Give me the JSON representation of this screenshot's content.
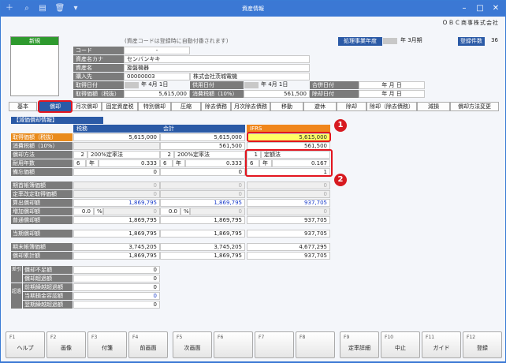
{
  "window": {
    "title": "資産情報",
    "company": "ＯＢＣ商事株式会社"
  },
  "photo": {
    "header": "新規"
  },
  "note": "(資産コードは登録時に自動付番されます)",
  "fiscal": {
    "label": "処理事業年度",
    "value": "年 3月期"
  },
  "count": {
    "label": "登録件数",
    "value": "36"
  },
  "fields": {
    "code": {
      "label": "コード",
      "value": "-"
    },
    "kana": {
      "label": "資産名カナ",
      "value": "センバンキキ"
    },
    "name": {
      "label": "資産名",
      "value": "旋盤機器"
    },
    "supplier": {
      "label": "購入先",
      "code": "00000003",
      "name": "株式会社茨城電機"
    },
    "acquired": {
      "label": "取得日付",
      "value": "年 4月 1日"
    },
    "inservice": {
      "label": "供用日付",
      "value": "年 4月 1日"
    },
    "merged": {
      "label": "合併日付",
      "value": "年 月 日"
    },
    "cost": {
      "label": "取得価額（税抜）",
      "value": "5,615,000"
    },
    "tax": {
      "label": "消費税額（10%）",
      "value": "561,500"
    },
    "disposal": {
      "label": "除却日付",
      "value": "年 月 日"
    }
  },
  "tabs": [
    "基本",
    "償却",
    "月次償却",
    "固定資産税",
    "特別償却",
    "圧縮",
    "除去債務",
    "月次除去債務",
    "移動",
    "遊休",
    "除却",
    "除却（除去債務）",
    "減損",
    "償却方法変更"
  ],
  "section_title": "【減価償却情報】",
  "columns": {
    "tax": "税務",
    "accounting": "会計",
    "ifrs": "IFRS"
  },
  "rows": {
    "cost": {
      "label": "取得価額（税抜）",
      "tax": "5,615,000",
      "acc": "5,615,000",
      "ifrs": "5,615,000"
    },
    "vat": {
      "label": "消費税額（10%）",
      "acc": "561,500",
      "ifrs": "561,500"
    },
    "method": {
      "label": "償却方法",
      "tax_no": "2",
      "tax": "200%定率法",
      "acc_no": "2",
      "acc": "200%定率法",
      "ifrs_no": "1",
      "ifrs": "定額法"
    },
    "life": {
      "label": "耐用年数",
      "tax_years": "6",
      "unit": "年",
      "tax_rate": "0.333",
      "acc_years": "6",
      "acc_rate": "0.333",
      "ifrs_years": "6",
      "ifrs_rate": "0.167"
    },
    "memo": {
      "label": "備忘価額",
      "tax": "0",
      "acc": "0",
      "ifrs": "1"
    },
    "begin_book": {
      "label": "期首帳簿価額",
      "tax": "0",
      "acc": "0",
      "ifrs": "0"
    },
    "fixed_change": {
      "label": "定率改定取得価額",
      "tax": "0",
      "acc": "0",
      "ifrs": "0"
    },
    "calc_dep": {
      "label": "算出償却額",
      "tax": "1,869,795",
      "acc": "1,869,795",
      "ifrs": "937,705"
    },
    "extra_dep": {
      "label": "増加償却額",
      "pct": "0.0",
      "pct_unit": "%",
      "tax": "0",
      "acc": "0",
      "ifrs": "0"
    },
    "normal_dep": {
      "label": "普通償却額",
      "tax": "1,869,795",
      "acc": "1,869,795",
      "ifrs": "937,705"
    },
    "current_dep": {
      "label": "当期償却額",
      "tax": "1,869,795",
      "acc": "1,869,795",
      "ifrs": "937,705"
    },
    "end_book": {
      "label": "期末帳簿価額",
      "tax": "3,745,205",
      "acc": "3,745,205",
      "ifrs": "4,677,295"
    },
    "accum": {
      "label": "償却累計額",
      "tax": "1,869,795",
      "acc": "1,869,795",
      "ifrs": "937,705"
    }
  },
  "excess": {
    "side1": "差引",
    "side2": "超過",
    "rows": [
      {
        "label": "償却不足額",
        "value": "0"
      },
      {
        "label": "償却超過額",
        "value": "0"
      },
      {
        "label": "前期繰越超過額",
        "value": "0"
      },
      {
        "label": "当期損金容認額",
        "value": "0"
      },
      {
        "label": "翌期繰越超過額",
        "value": "0"
      }
    ]
  },
  "badges": [
    "1",
    "2"
  ],
  "fkeys": [
    {
      "n": "F1",
      "t": "ヘルプ"
    },
    {
      "n": "F2",
      "t": "画像"
    },
    {
      "n": "F3",
      "t": "付箋"
    },
    {
      "n": "F4",
      "t": "前画面"
    },
    {
      "n": "F5",
      "t": "次画面"
    },
    {
      "n": "F6",
      "t": ""
    },
    {
      "n": "F7",
      "t": ""
    },
    {
      "n": "F8",
      "t": ""
    },
    {
      "n": "F9",
      "t": "定率詳細"
    },
    {
      "n": "F10",
      "t": "中止"
    },
    {
      "n": "F11",
      "t": "ガイド"
    },
    {
      "n": "F12",
      "t": "登録"
    }
  ]
}
